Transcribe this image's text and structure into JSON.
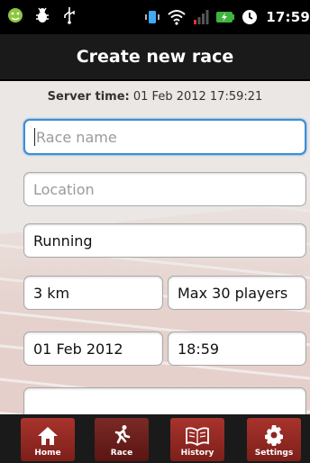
{
  "status_bar": {
    "clock": "17:59",
    "left_icons": [
      "android-icon",
      "bug-icon",
      "usb-icon"
    ],
    "right_icons": [
      "vibrate-icon",
      "wifi-icon",
      "signal-icon",
      "battery-icon",
      "alarm-icon"
    ]
  },
  "header": {
    "title": "Create new race"
  },
  "server_time": {
    "label": "Server time:",
    "value": "01 Feb 2012 17:59:21"
  },
  "form": {
    "race_name_placeholder": "Race name",
    "location_placeholder": "Location",
    "sport_value": "Running",
    "distance_value": "3 km",
    "max_players_value": "Max 30 players",
    "date_value": "01 Feb 2012",
    "time_value": "18:59"
  },
  "bottom_nav": {
    "items": [
      {
        "label": "Home",
        "icon": "home-icon"
      },
      {
        "label": "Race",
        "icon": "runner-icon"
      },
      {
        "label": "History",
        "icon": "book-icon"
      },
      {
        "label": "Settings",
        "icon": "gear-icon"
      }
    ],
    "active": "Race"
  },
  "colors": {
    "accent_focus": "#3b8ed6",
    "nav_red": "#a8332c"
  }
}
